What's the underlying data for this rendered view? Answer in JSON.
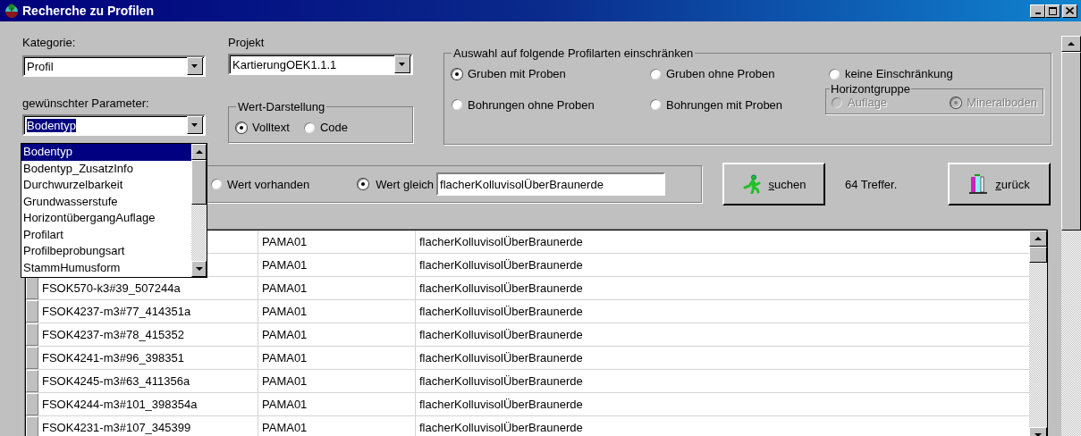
{
  "window": {
    "title": "Recherche zu Profilen"
  },
  "kategorie": {
    "label": "Kategorie:",
    "value": "Profil"
  },
  "projekt": {
    "label": "Projekt",
    "value": "KartierungOEK1.1.1"
  },
  "parameter": {
    "label": "gewünschter Parameter:",
    "value": "Bodentyp",
    "expanded": true,
    "options": [
      {
        "label": "Bodentyp",
        "selected": true
      },
      {
        "label": "Bodentyp_ZusatzInfo",
        "selected": false
      },
      {
        "label": "Durchwurzelbarkeit",
        "selected": false
      },
      {
        "label": "Grundwasserstufe",
        "selected": false
      },
      {
        "label": "HorizontübergangAuflage",
        "selected": false
      },
      {
        "label": "Profilart",
        "selected": false
      },
      {
        "label": "Profilbeprobungsart",
        "selected": false
      },
      {
        "label": "StammHumusform",
        "selected": false
      }
    ]
  },
  "wert_darstellung": {
    "title": "Wert-Darstellung",
    "options": [
      {
        "label": "Volltext",
        "selected": true
      },
      {
        "label": "Code",
        "selected": false
      }
    ]
  },
  "profilarten": {
    "title": "Auswahl auf folgende Profilarten einschränken",
    "options": [
      {
        "label": "Gruben mit Proben",
        "selected": true
      },
      {
        "label": "Gruben ohne Proben",
        "selected": false
      },
      {
        "label": "keine Einschränkung",
        "selected": false
      },
      {
        "label": "Bohrungen ohne Proben",
        "selected": false
      },
      {
        "label": "Bohrungen mit Proben",
        "selected": false
      }
    ],
    "horizontgruppe": {
      "title": "Horizontgruppe",
      "disabled": true,
      "options": [
        {
          "label": "Auflage",
          "selected": false
        },
        {
          "label": "Mineralboden",
          "selected": true
        }
      ]
    }
  },
  "filter": {
    "options": [
      {
        "label": "Wert vorhanden",
        "selected": false
      },
      {
        "label": "Wert gleich",
        "selected": true
      }
    ],
    "value": "flacherKolluvisolÜberBraunerde"
  },
  "search_button": {
    "label": "suchen"
  },
  "result_count": "64 Treffer.",
  "back_button": {
    "label": "zurück"
  },
  "rows": [
    {
      "project": "PAMA01",
      "value": "flacherKolluvisolÜberBraunerde"
    },
    {
      "project": "PAMA01",
      "value": "flacherKolluvisolÜberBraunerde"
    },
    {
      "id": "FSOK570-k3#39_507244a",
      "project": "PAMA01",
      "value": "flacherKolluvisolÜberBraunerde"
    },
    {
      "id": "FSOK4237-m3#77_414351a",
      "project": "PAMA01",
      "value": "flacherKolluvisolÜberBraunerde"
    },
    {
      "id": "FSOK4237-m3#78_415352",
      "project": "PAMA01",
      "value": "flacherKolluvisolÜberBraunerde"
    },
    {
      "id": "FSOK4241-m3#96_398351",
      "project": "PAMA01",
      "value": "flacherKolluvisolÜberBraunerde"
    },
    {
      "id": "FSOK4245-m3#63_411356a",
      "project": "PAMA01",
      "value": "flacherKolluvisolÜberBraunerde"
    },
    {
      "id": "FSOK4244-m3#101_398354a",
      "project": "PAMA01",
      "value": "flacherKolluvisolÜberBraunerde"
    },
    {
      "id": "FSOK4231-m3#107_345399",
      "project": "PAMA01",
      "value": "flacherKolluvisolÜberBraunerde"
    }
  ]
}
